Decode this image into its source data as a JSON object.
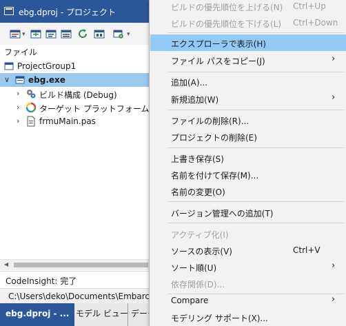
{
  "panel": {
    "title": "ebg.dproj - プロジェクト",
    "file_label": "ファイル",
    "tree": [
      {
        "label": "ProjectGroup1"
      },
      {
        "label": "ebg.exe"
      },
      {
        "label": "ビルド構成 (Debug)"
      },
      {
        "label": "ターゲット プラットフォーム (Wind"
      },
      {
        "label": "frmuMain.pas"
      }
    ],
    "status_codeinsight": "CodeInsight: 完了",
    "status_path": "C:\\Users\\deko\\Documents\\Embarcade",
    "tabs": [
      "ebg.dproj - ...",
      "モデル ビュー",
      "データ"
    ]
  },
  "menu": {
    "items": [
      {
        "label": "ビルドの優先順位を上げる(N)",
        "shortcut": "Ctrl+Up",
        "disabled": true
      },
      {
        "label": "ビルドの優先順位を下げる(L)",
        "shortcut": "Ctrl+Down",
        "disabled": true
      },
      {
        "label": "エクスプローラで表示(H)",
        "highlighted": true
      },
      {
        "label": "ファイル パスをコピー(J)",
        "submenu": true
      },
      {
        "label": "追加(A)..."
      },
      {
        "label": "新規追加(W)",
        "submenu": true
      },
      {
        "label": "ファイルの削除(R)..."
      },
      {
        "label": "プロジェクトの削除(E)"
      },
      {
        "label": "上書き保存(S)"
      },
      {
        "label": "名前を付けて保存(M)..."
      },
      {
        "label": "名前の変更(O)"
      },
      {
        "label": "バージョン管理への追加(T)"
      },
      {
        "label": "アクティブ化(I)",
        "disabled": true
      },
      {
        "label": "ソースの表示(V)",
        "shortcut": "Ctrl+V"
      },
      {
        "label": "ソート順(U)",
        "submenu": true
      },
      {
        "label": "依存関係(D)...",
        "disabled": true
      },
      {
        "label": "Compare",
        "submenu": true
      },
      {
        "label": "モデリング サポート(X)..."
      }
    ]
  },
  "colors": {
    "accent": "#2b579a",
    "selection": "#99c9ef",
    "menu_highlight": "#91c9f7"
  }
}
